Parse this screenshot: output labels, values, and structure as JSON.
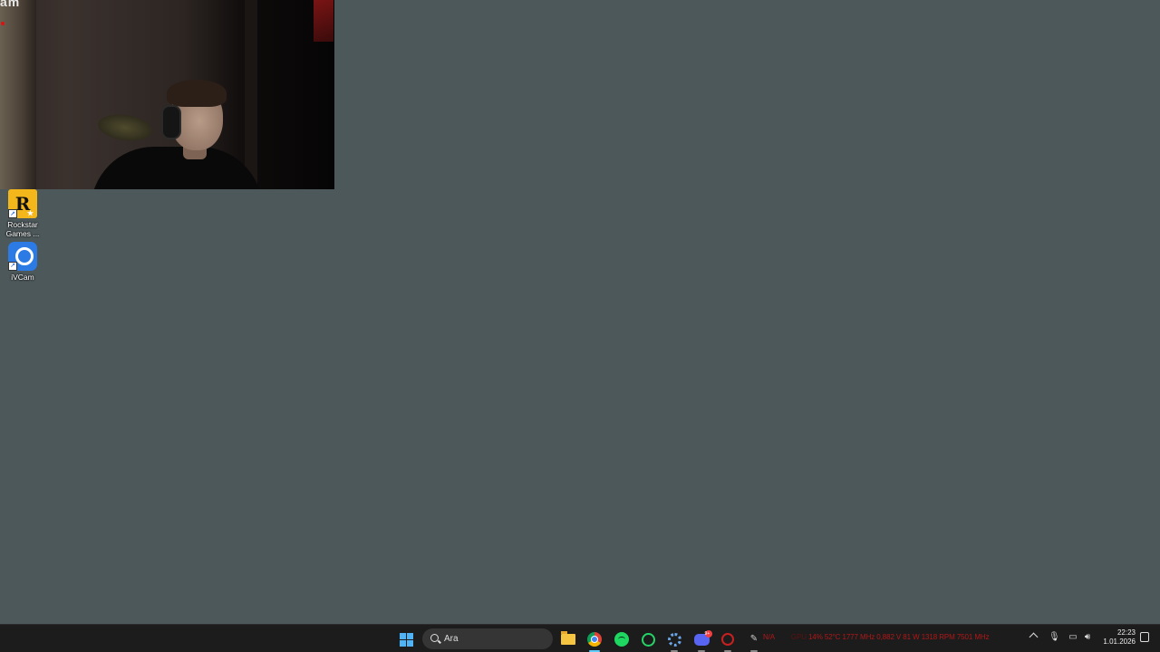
{
  "webcam": {
    "overlay_text": "am"
  },
  "desktop": {
    "icons": [
      {
        "label": "Rockstar Games ...",
        "icon": "rockstar-games-icon",
        "glyph": "R"
      },
      {
        "label": "iVCam",
        "icon": "ivcam-icon"
      }
    ]
  },
  "taskbar": {
    "search_placeholder": "Ara",
    "apps": [
      "start-icon",
      "file-explorer-icon",
      "chrome-icon",
      "spotify-icon",
      "whatsapp-icon",
      "settings-gear-icon",
      "discord-icon",
      "red-circle-app-icon",
      "pen-app-icon"
    ],
    "discord_badge": "9+",
    "hardware_overlay": {
      "prefix": "N/A",
      "gpu_label": "GPU",
      "gpu_usage": "14%",
      "gpu_temp": "52°C",
      "gpu_clock": "1777 MHz",
      "gpu_voltage": "0,882 V",
      "gpu_power": "81 W",
      "fan_rpm": "1318 RPM",
      "mem_clock": "7501 MHz"
    },
    "clock": {
      "time": "22:23",
      "date": "1.01.2026"
    }
  },
  "colors": {
    "desktop_bg": "#4d585b",
    "taskbar_bg": "#1c1c1c",
    "overlay_red": "#b01818",
    "accent": "#60cdff"
  }
}
